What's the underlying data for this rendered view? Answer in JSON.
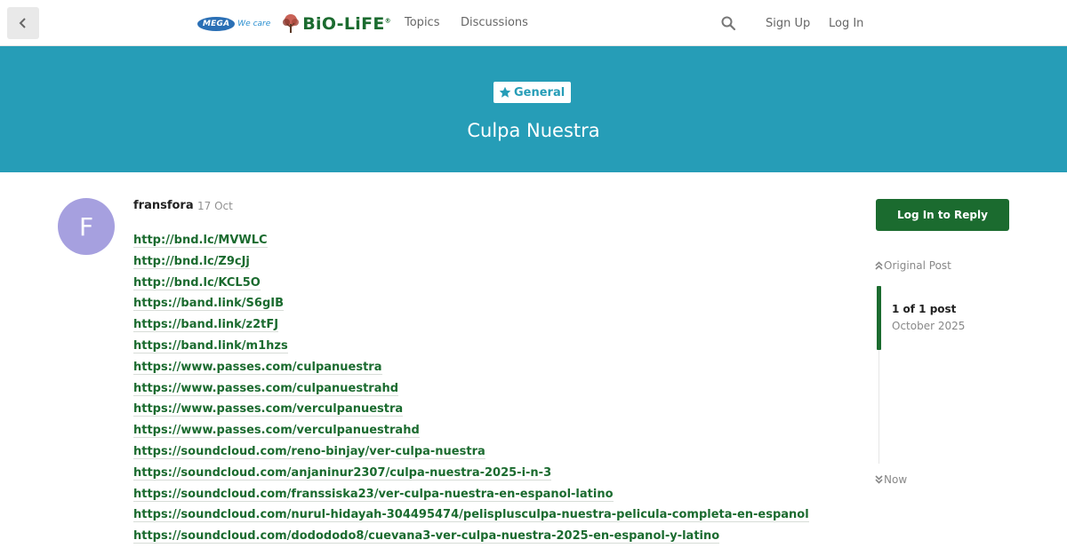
{
  "header": {
    "logo": {
      "mega_text": "MEGA",
      "wecare_text": "We care",
      "brand_text": "BiO-LiFE",
      "brand_reg": "®"
    },
    "nav": {
      "topics_label": "Topics",
      "discussions_label": "Discussions"
    },
    "signup_label": "Sign Up",
    "login_label": "Log In"
  },
  "banner": {
    "category_label": "General",
    "category_icon": "star-icon",
    "title": "Culpa Nuestra"
  },
  "post": {
    "avatar_letter": "F",
    "avatar_color": "#a6a0df",
    "username": "fransfora",
    "date": "17 Oct",
    "links": [
      "http://bnd.lc/MVWLC",
      "http://bnd.lc/Z9cJj",
      "http://bnd.lc/KCL5O",
      "https://band.link/S6gIB",
      "https://band.link/z2tFJ",
      "https://band.link/m1hzs",
      "https://www.passes.com/culpanuestra",
      "https://www.passes.com/culpanuestrahd",
      "https://www.passes.com/verculpanuestra",
      "https://www.passes.com/verculpanuestrahd",
      "https://soundcloud.com/reno-binjay/ver-culpa-nuestra",
      "https://soundcloud.com/anjaninur2307/culpa-nuestra-2025-i-n-3",
      "https://soundcloud.com/franssiska23/ver-culpa-nuestra-en-espanol-latino",
      "https://soundcloud.com/nurul-hidayah-304495474/pelisplusculpa-nuestra-pelicula-completa-en-espanol",
      "https://soundcloud.com/dodododo8/cuevana3-ver-culpa-nuestra-2025-en-espanol-y-latino"
    ]
  },
  "sidebar": {
    "reply_label": "Log In to Reply",
    "original_post_label": "Original Post",
    "post_count": "1 of 1 post",
    "post_month": "October 2025",
    "now_label": "Now"
  },
  "colors": {
    "brand_green": "#1b6b2f",
    "banner_teal": "#269db7"
  }
}
